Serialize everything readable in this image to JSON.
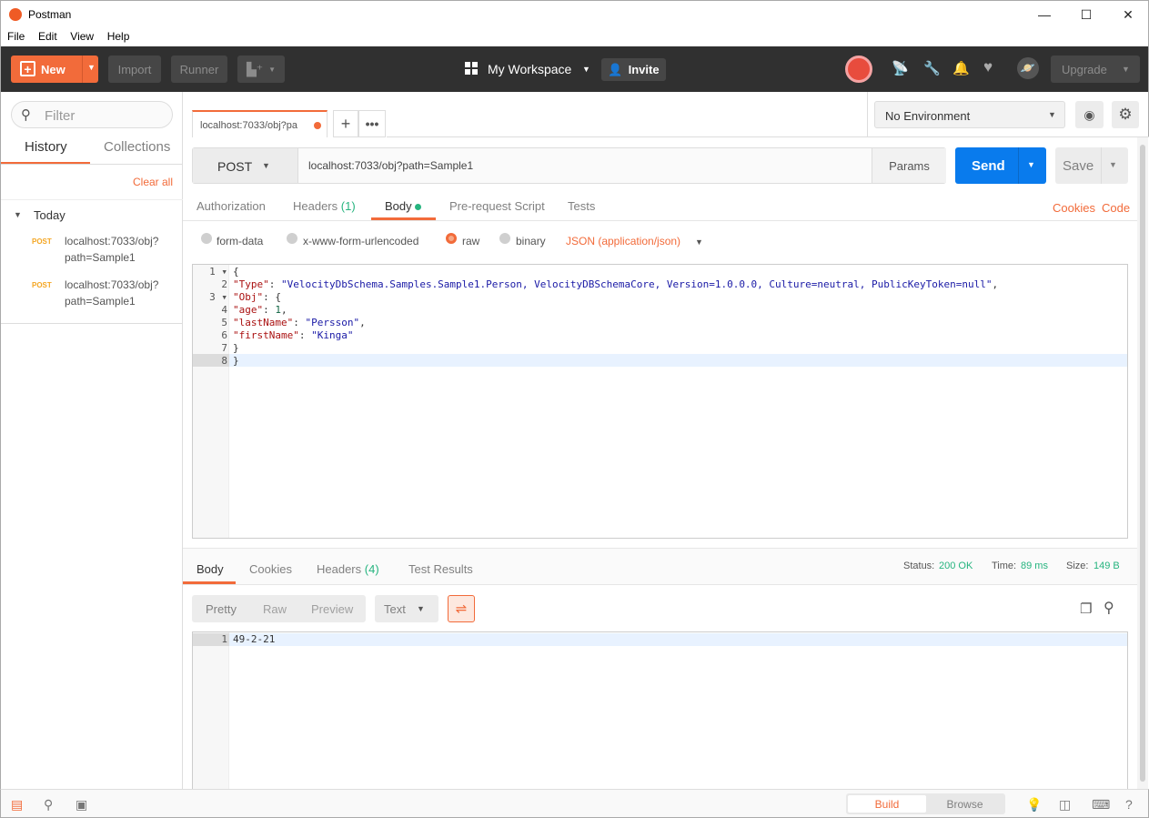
{
  "window": {
    "title": "Postman",
    "minimize": "—",
    "maximize": "☐",
    "close": "✕"
  },
  "menu": [
    "File",
    "Edit",
    "View",
    "Help"
  ],
  "header": {
    "new_label": "New",
    "import_label": "Import",
    "runner_label": "Runner",
    "workspace_label": "My Workspace",
    "invite_label": "Invite",
    "upgrade_label": "Upgrade"
  },
  "sidebar": {
    "filter_placeholder": "Filter",
    "tabs": [
      "History",
      "Collections"
    ],
    "clear_all": "Clear all",
    "group_label": "Today",
    "items": [
      {
        "method": "POST",
        "url_line1": "localhost:7033/obj?",
        "url_line2": "path=Sample1"
      },
      {
        "method": "POST",
        "url_line1": "localhost:7033/obj?",
        "url_line2": "path=Sample1"
      }
    ]
  },
  "request_tab": {
    "label": "localhost:7033/obj?pa"
  },
  "environment": {
    "selected": "No Environment"
  },
  "request": {
    "method": "POST",
    "url": "localhost:7033/obj?path=Sample1",
    "params_label": "Params",
    "send_label": "Send",
    "save_label": "Save"
  },
  "request_tabs": {
    "authorization": "Authorization",
    "headers": "Headers",
    "headers_count": "(1)",
    "body": "Body",
    "prerequest": "Pre-request Script",
    "tests": "Tests",
    "cookies": "Cookies",
    "code": "Code"
  },
  "body_modes": {
    "form_data": "form-data",
    "urlencoded": "x-www-form-urlencoded",
    "raw": "raw",
    "binary": "binary",
    "content_type": "JSON (application/json)"
  },
  "request_body_lines": [
    "{",
    "\"Type\": \"VelocityDbSchema.Samples.Sample1.Person, VelocityDBSchemaCore, Version=1.0.0.0, Culture=neutral, PublicKeyToken=null\",",
    "\"Obj\": {",
    "\"age\": 1,",
    "\"lastName\": \"Persson\",",
    "\"firstName\": \"Kinga\"",
    "}",
    "}"
  ],
  "response": {
    "tabs": {
      "body": "Body",
      "cookies": "Cookies",
      "headers": "Headers",
      "headers_count": "(4)",
      "test_results": "Test Results"
    },
    "status_label": "Status:",
    "status_value": "200 OK",
    "time_label": "Time:",
    "time_value": "89 ms",
    "size_label": "Size:",
    "size_value": "149 B",
    "view_modes": [
      "Pretty",
      "Raw",
      "Preview"
    ],
    "format": "Text",
    "body_lines": [
      "49-2-21"
    ]
  },
  "footer": {
    "build": "Build",
    "browse": "Browse"
  },
  "colors": {
    "accent": "#f26b3a",
    "send": "#097bed",
    "success": "#26b47f",
    "header_bg": "#303030"
  }
}
